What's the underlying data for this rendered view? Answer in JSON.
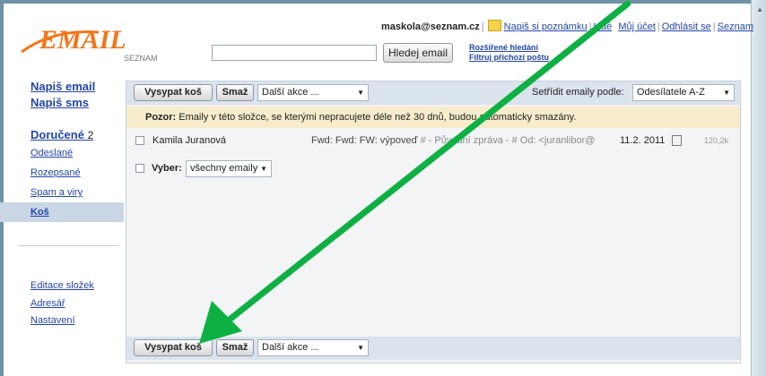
{
  "header": {
    "user_email": "maskola@seznam.cz",
    "links": [
      "Napiš si poznámku",
      "Lidé",
      "Můj účet",
      "Odhlásit se",
      "Seznam"
    ],
    "search_button": "Hledej email",
    "search_placeholder": "",
    "advanced_search": "Rozšířené hledání",
    "filter_incoming": "Filtruj příchozí poštu"
  },
  "logo": {
    "wordmark": "EMAIL",
    "brand": "SEZNAM"
  },
  "sidebar": {
    "compose_email": "Napiš email",
    "compose_sms": "Napiš sms",
    "inbox": "Doručené",
    "inbox_count": "2",
    "folders": [
      "Odeslané",
      "Rozepsané",
      "Spam a viry",
      "Koš"
    ],
    "bottom_links": [
      "Editace složek",
      "Adresář",
      "Nastavení"
    ]
  },
  "toolbar": {
    "empty_trash": "Vysypat koš",
    "delete": "Smaž",
    "more_actions": "Další akce ...",
    "sort_label": "Setřídit emaily podle:",
    "sort_value": "Odesílatele A-Z"
  },
  "warning": {
    "bold": "Pozor:",
    "text": "Emaily v této složce, se kterými nepracujete déle než 30 dnů, budou automaticky smazány."
  },
  "emails": [
    {
      "sender": "Kamila Juranová",
      "subject": "Fwd: Fwd: FW: výpoveď",
      "preview": "# - Původní zpráva - # Od: <juranlibor@",
      "date": "11.2. 2011",
      "size": "120,2k"
    }
  ],
  "select_row": {
    "label": "Vyber:",
    "value": "všechny emaily"
  },
  "colors": {
    "accent_orange": "#f0771c",
    "link_blue": "#2246a6",
    "arrow_green": "#0fb043"
  }
}
